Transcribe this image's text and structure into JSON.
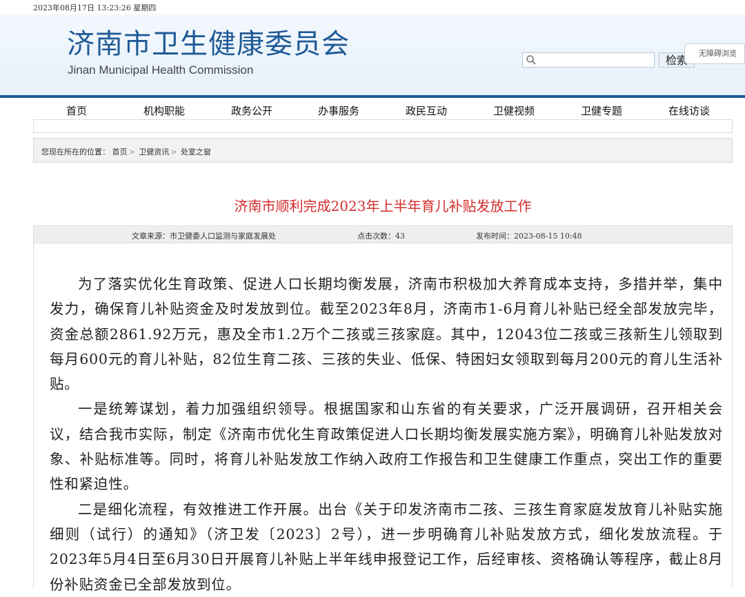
{
  "datetime": "2023年08月17日  13:23:26  星期四",
  "header": {
    "title": "济南市卫生健康委员会",
    "subtitle": "Jinan Municipal Health Commission",
    "search_button": "检索",
    "accessibility_button": "无障碍浏览"
  },
  "nav": {
    "items": [
      "首页",
      "机构职能",
      "政务公开",
      "办事服务",
      "政民互动",
      "卫健视频",
      "卫健专题",
      "在线访谈"
    ]
  },
  "breadcrumb": {
    "prefix": "您现在所在的位置：",
    "items": [
      "首页",
      "卫健资讯",
      "处室之窗"
    ],
    "separator": ">"
  },
  "article": {
    "title": "济南市顺利完成2023年上半年育儿补贴发放工作",
    "source": "文章来源：市卫健委人口监测与家庭发展处",
    "clicks": "点击次数：43",
    "published": "发布时间：2023-08-15 10:48",
    "paragraphs": [
      "为了落实优化生育政策、促进人口长期均衡发展，济南市积极加大养育成本支持，多措并举，集中发力，确保育儿补贴资金及时发放到位。截至2023年8月，济南市1-6月育儿补贴已经全部发放完毕，资金总额2861.92万元，惠及全市1.2万个二孩或三孩家庭。其中，12043位二孩或三孩新生儿领取到每月600元的育儿补贴，82位生育二孩、三孩的失业、低保、特困妇女领取到每月200元的育儿生活补贴。",
      "一是统筹谋划，着力加强组织领导。根据国家和山东省的有关要求，广泛开展调研，召开相关会议，结合我市实际，制定《济南市优化生育政策促进人口长期均衡发展实施方案》，明确育儿补贴发放对象、补贴标准等。同时，将育儿补贴发放工作纳入政府工作报告和卫生健康工作重点，突出工作的重要性和紧迫性。",
      "二是细化流程，有效推进工作开展。出台《关于印发济南市二孩、三孩生育家庭发放育儿补贴实施细则（试行）的通知》（济卫发〔2023〕2号），进一步明确育儿补贴发放方式，细化发放流程。于2023年5月4日至6月30日开展育儿补贴上半年线申报登记工作，后经审核、资格确认等程序，截止8月份补贴资金已全部发放到位。"
    ]
  }
}
